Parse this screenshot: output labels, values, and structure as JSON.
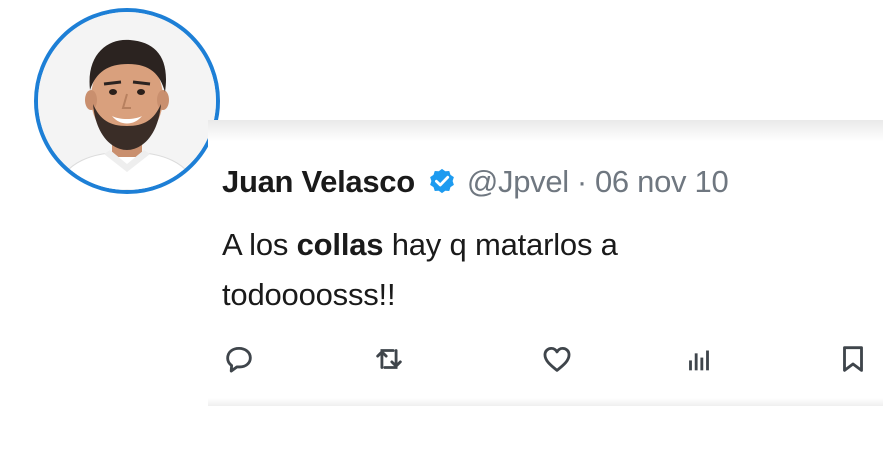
{
  "author": {
    "display_name": "Juan Velasco",
    "handle": "@Jpvel",
    "separator": "·",
    "date": "06 nov 10",
    "verified_icon": "verified-badge-icon"
  },
  "tweet": {
    "text_before": "A los ",
    "text_bold": "collas",
    "text_after": " hay q matarlos a todoooosss!!"
  },
  "actions": [
    {
      "icon": "reply-icon"
    },
    {
      "icon": "retweet-icon"
    },
    {
      "icon": "like-icon"
    },
    {
      "icon": "views-icon"
    },
    {
      "icon": "bookmark-icon"
    }
  ],
  "colors": {
    "avatar_ring": "#1d7fd6",
    "verified": "#1d9bf0",
    "text": "#1a1a1a",
    "muted": "#6f7780"
  }
}
